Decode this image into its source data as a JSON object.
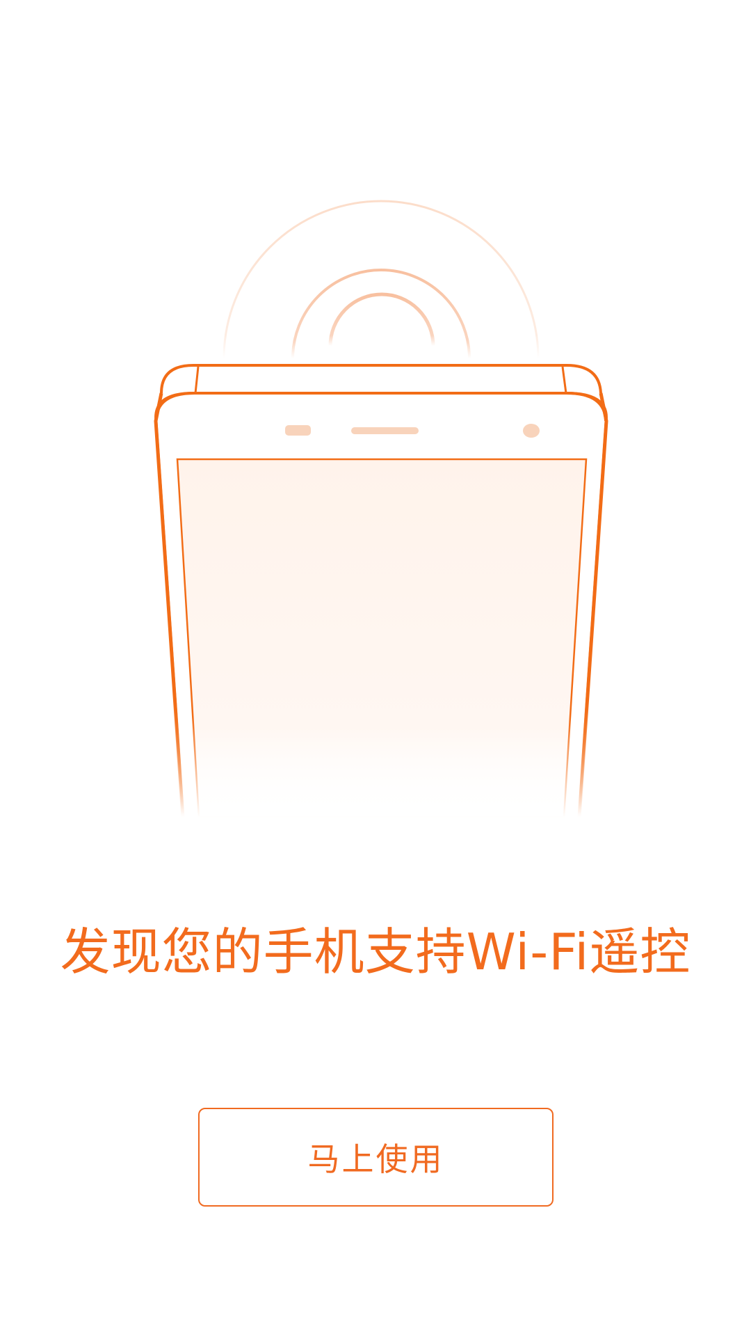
{
  "colors": {
    "accent": "#f26b1d",
    "phone_outline": "#f26c16",
    "signal_ring": "#f8c6a5",
    "screen_fill": "#fff5ef"
  },
  "illustration": {
    "phone_icon": "phone-outline-icon",
    "signal_icon": "wifi-signal-rings-icon"
  },
  "headline": "发现您的手机支持Wi-Fi遥控",
  "button": {
    "label": "马上使用"
  }
}
